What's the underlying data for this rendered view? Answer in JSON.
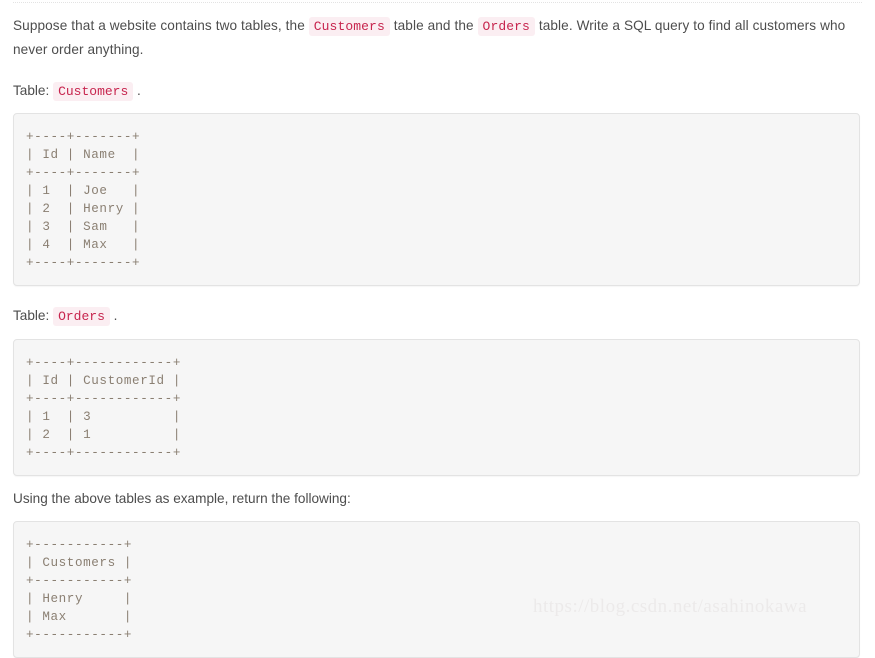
{
  "document": {
    "intro": {
      "before_customers": "Suppose that a website contains two tables, the ",
      "code_customers": "Customers",
      "between_codes": " table and the ",
      "code_orders": "Orders",
      "after_orders": " table. Write a SQL query to find all customers who never order anything."
    },
    "customers_label": {
      "prefix": "Table: ",
      "code": "Customers",
      "suffix": " ."
    },
    "customers_code_block": "+----+-------+\n| Id | Name  |\n+----+-------+\n| 1  | Joe   |\n| 2  | Henry |\n| 3  | Sam   |\n| 4  | Max   |\n+----+-------+",
    "orders_label": {
      "prefix": "Table: ",
      "code": "Orders",
      "suffix": " ."
    },
    "orders_code_block": "+----+------------+\n| Id | CustomerId |\n+----+------------+\n| 1  | 3          |\n| 2  | 1          |\n+----+------------+",
    "result_intro": "Using the above tables as example, return the following:",
    "result_code_block": "+-----------+\n| Customers |\n+-----------+\n| Henry     |\n| Max       |\n+-----------+",
    "watermark": "https://blog.csdn.net/asahinokawa",
    "colors": {
      "inline_code_text": "#c7254e",
      "inline_code_bg": "#fbeef2",
      "code_block_bg": "#f6f6f6",
      "code_block_border": "#e3e3e3",
      "body_text": "#4d4d4d",
      "watermark": "#eceaea"
    }
  }
}
